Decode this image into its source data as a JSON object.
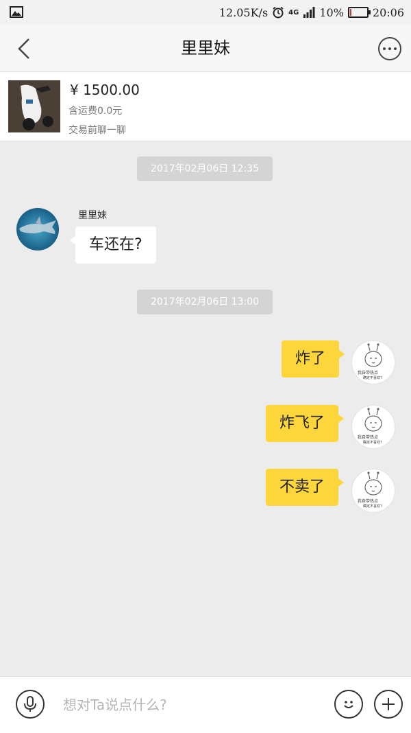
{
  "status_bar": {
    "speed": "12.05K/s",
    "network": "4G",
    "battery": "10%",
    "battery_level": 0.1,
    "time": "20:06"
  },
  "nav": {
    "title": "里里妹"
  },
  "product": {
    "price": "¥ 1500.00",
    "shipping": "含运费0.0元",
    "hint": "交易前聊一聊"
  },
  "messages": {
    "ts1": "2017年02月06日 12:35",
    "sender": "里里妹",
    "m1": "车还在?",
    "ts2": "2017年02月06日 13:00",
    "m2": "炸了",
    "m3": "炸飞了",
    "m4": "不卖了",
    "sticker_text_1": "我自带热点",
    "sticker_text_2": "确定不喜欢?"
  },
  "input": {
    "placeholder": "想对Ta说点什么?"
  },
  "icons": {
    "back": "chevron-left-icon",
    "more": "more-dots-icon",
    "voice": "microphone-icon",
    "emoji": "smiley-icon",
    "add": "plus-icon"
  },
  "colors": {
    "accent_bubble": "#fcd63a",
    "background": "#ececec",
    "timestamp_bg": "#d4d4d4"
  }
}
